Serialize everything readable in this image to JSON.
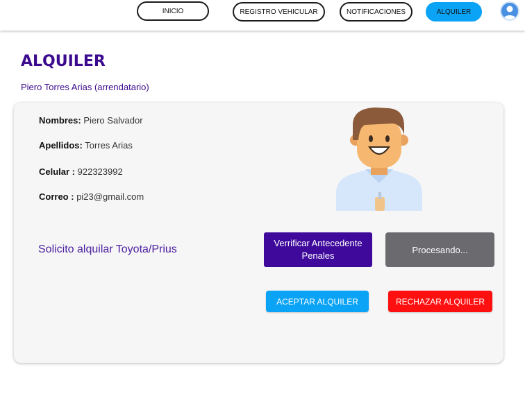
{
  "nav": {
    "inicio": "INICIO",
    "registro": "REGISTRO VEHICULAR",
    "notificaciones": "NOTIFICACIONES",
    "alquiler": "ALQUILER"
  },
  "page": {
    "title": "ALQUILER",
    "subtitle": "Piero Torres Arias (arrendatario)"
  },
  "profile": {
    "nombres_label": "Nombres:",
    "nombres_value": "Piero Salvador",
    "apellidos_label": "Apellidos:",
    "apellidos_value": "Torres Arias",
    "celular_label": "Celular :",
    "celular_value": "922323992",
    "correo_label": "Correo :",
    "correo_value": "pi23@gmail.com"
  },
  "request": {
    "text": "Solicito alquilar  Toyota/Prius"
  },
  "actions": {
    "verify": "Verrificar Antecedente Penales",
    "processing": "Procesando...",
    "accept": "ACEPTAR ALQUILER",
    "reject": "RECHAZAR ALQUILER"
  },
  "icons": {
    "user_avatar": "user-avatar-icon",
    "tenant_illustration": "tenant-illustration"
  },
  "colors": {
    "primary_purple": "#3f0a9c",
    "accent_blue": "#0aa3f5",
    "danger_red": "#ff1010",
    "processing_gray": "#6a6a6f"
  }
}
